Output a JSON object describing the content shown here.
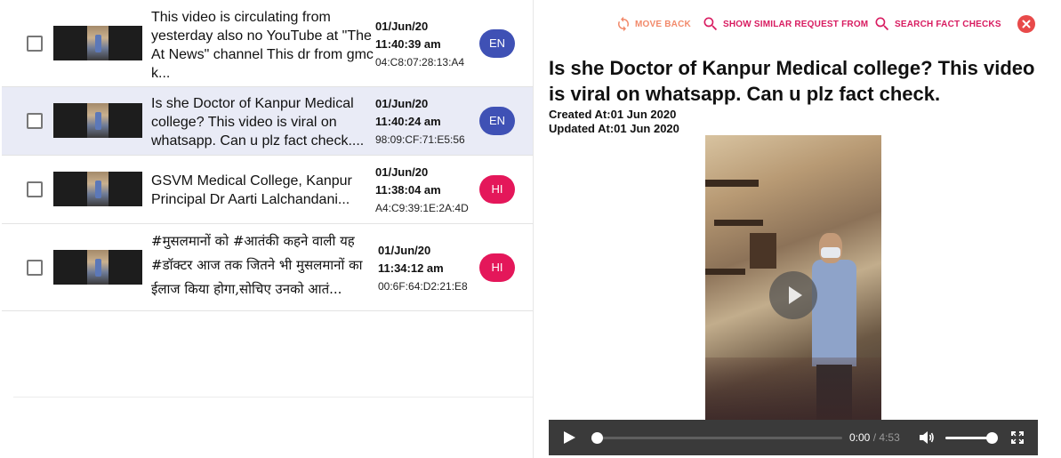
{
  "list": {
    "rows": [
      {
        "message": "This video is circulating from yesterday also no YouTube at \"The At News\" channel This dr from gmc k...",
        "date": "01/Jun/20",
        "time": "11:40:39 am",
        "device": "04:C8:07:28:13:A4",
        "lang": "EN",
        "selected": false
      },
      {
        "message": "Is she Doctor of Kanpur Medical college? This video is viral on whatsapp. Can u plz fact check....",
        "date": "01/Jun/20",
        "time": "11:40:24 am",
        "device": "98:09:CF:71:E5:56",
        "lang": "EN",
        "selected": true
      },
      {
        "message": "GSVM Medical College, Kanpur Principal Dr Aarti Lalchandani...",
        "date": "01/Jun/20",
        "time": "11:38:04 am",
        "device": "A4:C9:39:1E:2A:4D",
        "lang": "HI",
        "selected": false
      },
      {
        "message": "#मुसलमानों को #आतंकी कहने वाली यह #डॉक्टर आज तक जितने भी मुसलमानों का ईलाज किया होगा,सोचिए उनको आतं...",
        "date": "01/Jun/20",
        "time": "11:34:12 am",
        "device": "00:6F:64:D2:21:E8",
        "lang": "HI",
        "selected": false
      }
    ]
  },
  "detail": {
    "actions": {
      "move_back": "MOVE BACK",
      "show_similar": "SHOW SIMILAR REQUEST FROM",
      "search_fact_checks": "SEARCH FACT CHECKS"
    },
    "title": "Is she Doctor of Kanpur Medical college? This video is viral on whatsapp. Can u plz fact check.",
    "created": "Created At:01 Jun 2020",
    "updated": "Updated At:01 Jun 2020",
    "player": {
      "current_time": "0:00",
      "separator": "/",
      "duration": "4:53",
      "progress": 0,
      "volume": 1
    }
  },
  "colors": {
    "accent_pink": "#d81b60",
    "move_back_orange": "#f28a6b",
    "close_red": "#e84a4a",
    "lang_en": "#3f51b5",
    "lang_hi": "#e4175a",
    "selected_row": "#e9ebf6"
  },
  "icons": {
    "move_back": "refresh-icon",
    "show_similar": "search-icon",
    "search_fact_checks": "search-icon",
    "close": "close-icon",
    "play": "play-icon",
    "volume": "volume-icon",
    "fullscreen": "fullscreen-icon"
  }
}
